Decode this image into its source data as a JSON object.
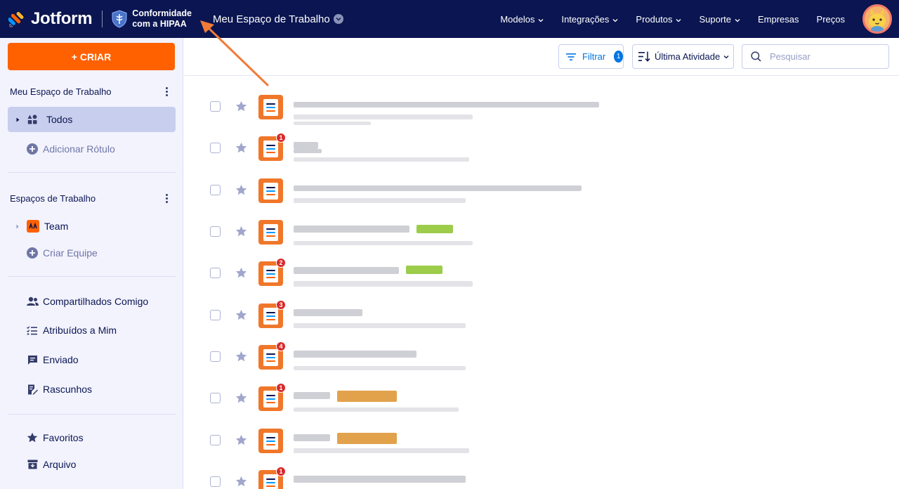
{
  "topbar": {
    "brand": "Jotform",
    "hipaa_line1": "Conformidade",
    "hipaa_line2": "com a HIPAA",
    "workspace_label": "Meu Espaço de Trabalho",
    "nav": [
      {
        "label": "Modelos"
      },
      {
        "label": "Integrações"
      },
      {
        "label": "Produtos"
      },
      {
        "label": "Suporte"
      },
      {
        "label": "Empresas"
      },
      {
        "label": "Preços"
      }
    ],
    "colors": {
      "bar": "#0a1551",
      "accent": "#ff6100"
    }
  },
  "sidebar": {
    "create_label": "+ CRIAR",
    "my_workspace_title": "Meu Espaço de Trabalho",
    "all_label": "Todos",
    "add_label": "Adicionar Rótulo",
    "workspaces_title": "Espaços de Trabalho",
    "team_label": "Team",
    "create_team_label": "Criar Equipe",
    "shared_label": "Compartilhados Comigo",
    "assigned_label": "Atribuídos a Mim",
    "sent_label": "Enviado",
    "drafts_label": "Rascunhos",
    "favorites_label": "Favoritos",
    "archive_label": "Arquivo"
  },
  "toolbar": {
    "filter_label": "Filtrar",
    "filter_count": "1",
    "sort_label": "Última Atividade",
    "search_placeholder": "Pesquisar"
  },
  "forms": [
    {
      "badge": ""
    },
    {
      "badge": "1"
    },
    {
      "badge": ""
    },
    {
      "badge": ""
    },
    {
      "badge": "2"
    },
    {
      "badge": "3"
    },
    {
      "badge": "4"
    },
    {
      "badge": "1"
    },
    {
      "badge": ""
    },
    {
      "badge": "1"
    }
  ]
}
